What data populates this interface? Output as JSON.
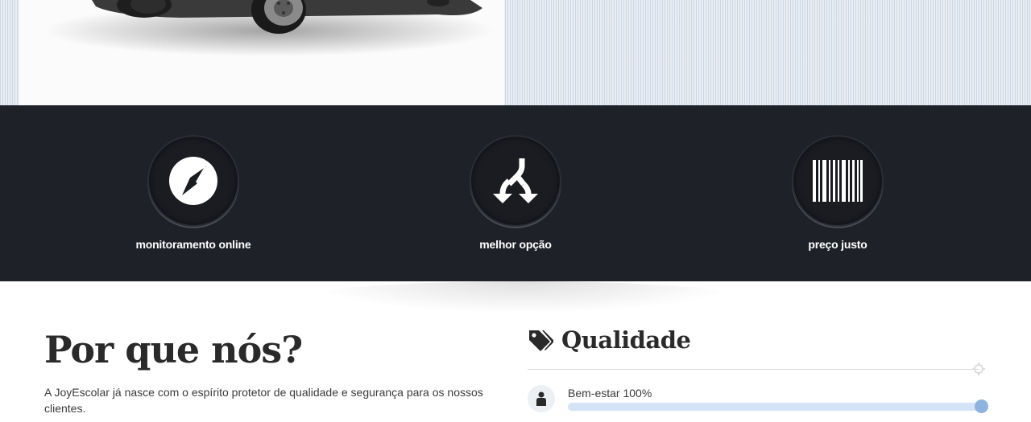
{
  "features": [
    {
      "icon": "compass-icon",
      "label": "monitoramento online"
    },
    {
      "icon": "split-arrows-icon",
      "label": "melhor opção"
    },
    {
      "icon": "barcode-icon",
      "label": "preço justo"
    }
  ],
  "why": {
    "title": "Por que nós?",
    "text": "A JoyEscolar já nasce com o espírito protetor de qualidade e segurança para os nossos clientes."
  },
  "quality": {
    "icon": "tags-icon",
    "title": "Qualidade",
    "divider_icon": "crosshair-icon",
    "skills": [
      {
        "icon": "person-icon",
        "label": "Bem-estar 100%",
        "value": 100
      }
    ]
  },
  "hero": {
    "image": "van-photo"
  },
  "colors": {
    "band": "#1f2129",
    "accent": "#8fb3df",
    "track": "#e2ebf5"
  }
}
